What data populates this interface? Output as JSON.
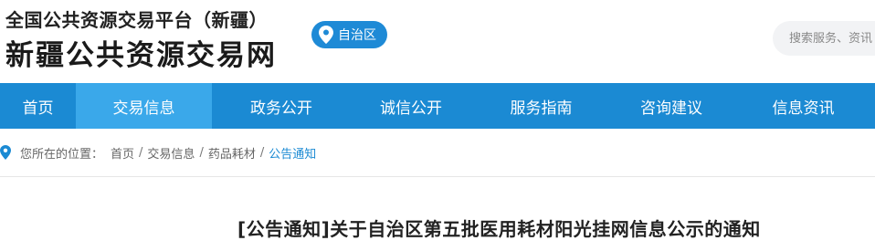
{
  "header": {
    "platform_title": "全国公共资源交易平台（新疆）",
    "site_title": "新疆公共资源交易网",
    "region_label": "自治区",
    "search_placeholder": "搜索服务、资讯"
  },
  "nav": {
    "items": [
      {
        "label": "首页"
      },
      {
        "label": "交易信息"
      },
      {
        "label": "政务公开"
      },
      {
        "label": "诚信公开"
      },
      {
        "label": "服务指南"
      },
      {
        "label": "咨询建议"
      },
      {
        "label": "信息资讯"
      }
    ],
    "active_index": 1
  },
  "breadcrumb": {
    "prefix": "您所在的位置：",
    "items": [
      "首页",
      "交易信息",
      "药品耗材",
      "公告通知"
    ],
    "separator": "/"
  },
  "article": {
    "title": "[公告通知]关于自治区第五批医用耗材阳光挂网信息公示的通知"
  },
  "colors": {
    "nav_bg": "#1b8ad3",
    "nav_active": "#3aa8ea",
    "badge_bg": "#1e8ad6",
    "link_current": "#1b8ad3"
  }
}
